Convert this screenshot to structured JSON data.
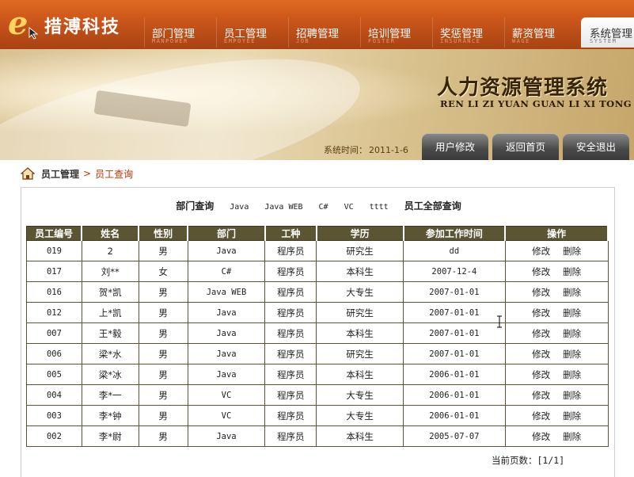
{
  "brand": {
    "letter": "e",
    "name": "措溥科技"
  },
  "nav": [
    {
      "label": "部门管理",
      "sub": "MANPOWER",
      "active": false
    },
    {
      "label": "员工管理",
      "sub": "EMPOYEE",
      "active": false
    },
    {
      "label": "招聘管理",
      "sub": "JOB",
      "active": false
    },
    {
      "label": "培训管理",
      "sub": "FOSTER",
      "active": false
    },
    {
      "label": "奖惩管理",
      "sub": "INSURANCE",
      "active": false
    },
    {
      "label": "薪资管理",
      "sub": "WAGE",
      "active": false
    },
    {
      "label": "系统管理",
      "sub": "SYSTEM",
      "active": true
    }
  ],
  "banner": {
    "title": "人力资源管理系统",
    "pinyin": "REN LI ZI YUAN GUAN LI XI TONG",
    "time_label": "系统时间：",
    "time_value": "2011-1-6",
    "buttons": [
      "用户修改",
      "返回首页",
      "安全退出"
    ]
  },
  "breadcrumb": {
    "parent": "员工管理",
    "separator": ">",
    "current": "员工查询"
  },
  "filters": {
    "dept_query": "部门查询",
    "depts": [
      "Java",
      "Java WEB",
      "C#",
      "VC",
      "tttt"
    ],
    "all_query": "员工全部查询"
  },
  "table": {
    "headers": [
      "员工编号",
      "姓名",
      "性别",
      "部门",
      "工种",
      "学历",
      "参加工作时间",
      "操作"
    ],
    "edit_label": "修改",
    "delete_label": "删除",
    "rows": [
      [
        "019",
        "2",
        "男",
        "Java",
        "程序员",
        "研究生",
        "dd"
      ],
      [
        "017",
        "刘**",
        "女",
        "C#",
        "程序员",
        "本科生",
        "2007-12-4"
      ],
      [
        "016",
        "贺*凯",
        "男",
        "Java WEB",
        "程序员",
        "大专生",
        "2007-01-01"
      ],
      [
        "012",
        "上*凯",
        "男",
        "Java",
        "程序员",
        "研究生",
        "2007-01-01"
      ],
      [
        "007",
        "王*毅",
        "男",
        "Java",
        "程序员",
        "本科生",
        "2007-01-01"
      ],
      [
        "006",
        "梁*水",
        "男",
        "Java",
        "程序员",
        "研究生",
        "2007-01-01"
      ],
      [
        "005",
        "梁*冰",
        "男",
        "Java",
        "程序员",
        "本科生",
        "2006-01-01"
      ],
      [
        "004",
        "李*一",
        "男",
        "VC",
        "程序员",
        "大专生",
        "2006-01-01"
      ],
      [
        "003",
        "李*钟",
        "男",
        "VC",
        "程序员",
        "大专生",
        "2006-01-01"
      ],
      [
        "002",
        "李*尉",
        "男",
        "Java",
        "程序员",
        "本科生",
        "2005-07-07"
      ]
    ]
  },
  "pager": {
    "label": "当前页数：",
    "value": "[1/1]"
  },
  "colors": {
    "nav_orange": "#c8541a",
    "table_header": "#5b5534",
    "crumb_active": "#c03000"
  }
}
